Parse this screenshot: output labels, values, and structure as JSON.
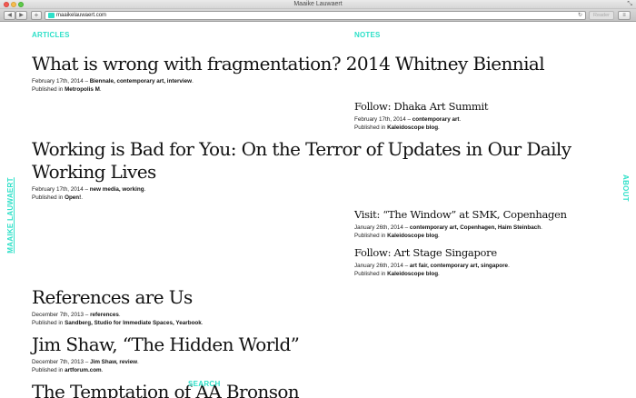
{
  "browser": {
    "window_title": "Maaike Lauwaert",
    "url": "maaikelauwaert.com",
    "reader_label": "Reader",
    "back_glyph": "◀",
    "forward_glyph": "▶",
    "add_glyph": "+",
    "reload_glyph": "↻",
    "sidebar_glyph": "≡",
    "resize_glyph": "⤡"
  },
  "nav": {
    "articles": "ARTICLES",
    "notes": "NOTES",
    "left_side": "MAAIKE LAUWAERT",
    "right_side": "ABOUT",
    "search": "SEARCH"
  },
  "articles": [
    {
      "title": "What is wrong with fragmentation? 2014 Whitney Biennial",
      "date": "February 17th, 2014 –",
      "tags": "Biennale, contemporary art, interview",
      "published_prefix": "Published in",
      "published_in": "Metropolis M"
    },
    {
      "title": "Working is Bad for You: On the Terror of Updates in Our Daily Working Lives",
      "date": "February 17th, 2014 –",
      "tags": "new media, working",
      "published_prefix": "Published in",
      "published_in": "Open!"
    },
    {
      "title": "References are Us",
      "date": "December 7th, 2013 –",
      "tags": "references",
      "published_prefix": "Published in",
      "published_in": "Sandberg, Studio for Immediate Spaces, Yearbook"
    },
    {
      "title": "Jim Shaw, “The Hidden World”",
      "date": "December 7th, 2013 –",
      "tags": "Jim Shaw, review",
      "published_prefix": "Published in",
      "published_in": "artforum.com"
    },
    {
      "title": "The Temptation of AA Bronson"
    }
  ],
  "notes": [
    {
      "title": "Follow: Dhaka Art Summit",
      "date": "February 17th, 2014 –",
      "tags": "contemporary art",
      "published_prefix": "Published in",
      "published_in": "Kaleidoscope blog"
    },
    {
      "title": "Visit: “The Window” at SMK, Copenhagen",
      "date": "January 26th, 2014 –",
      "tags": "contemporary art, Copenhagen, Haim Steinbach",
      "published_prefix": "Published in",
      "published_in": "Kaleidoscope blog"
    },
    {
      "title": "Follow: Art Stage Singapore",
      "date": "January 26th, 2014 –",
      "tags": "art fair, contemporary art, singapore",
      "published_prefix": "Published in",
      "published_in": "Kaleidoscope blog"
    }
  ],
  "colors": {
    "accent": "#2de0c8"
  }
}
